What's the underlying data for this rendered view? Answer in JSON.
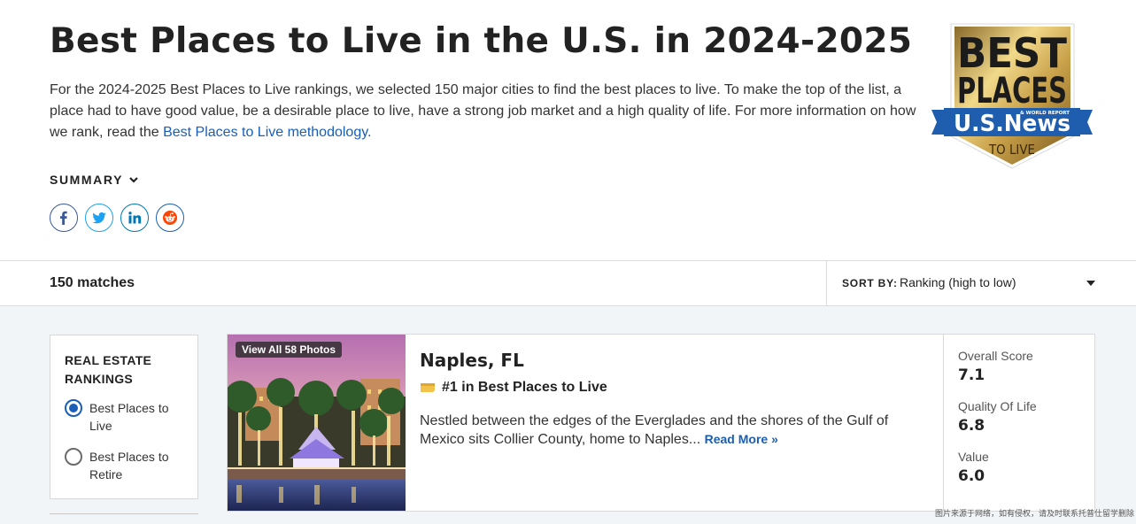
{
  "page": {
    "title": "Best Places to Live in the U.S. in 2024-2025",
    "intro_text": "For the 2024-2025 Best Places to Live rankings, we selected 150 major cities to find the best places to live. To make the top of the list, a place had to have good value, be a desirable place to live, have a strong job market and a high quality of life. For more information on how we rank, read the ",
    "intro_link": "Best Places to Live methodology.",
    "summary_label": "SUMMARY"
  },
  "badge": {
    "line1": "BEST",
    "line2": "PLACES",
    "brand": "U.S.News",
    "report": "& WORLD REPORT",
    "tagline": "TO LIVE"
  },
  "social": {
    "icons": [
      "facebook-icon",
      "twitter-icon",
      "linkedin-icon",
      "reddit-icon"
    ]
  },
  "toolbar": {
    "matches": "150 matches",
    "sort_label": "SORT BY:",
    "sort_value": "Ranking (high to low)"
  },
  "filter": {
    "title": "REAL ESTATE RANKINGS",
    "options": [
      {
        "label": "Best Places to Live",
        "selected": true
      },
      {
        "label": "Best Places to Retire",
        "selected": false
      }
    ]
  },
  "results": [
    {
      "photo_button": "View All 58 Photos",
      "city": "Naples, FL",
      "rank_text": "#1 in Best Places to Live",
      "description": "Nestled between the edges of the Everglades and the shores of the Gulf of Mexico sits Collier County, home to Naples... ",
      "read_more": "Read More »",
      "scores": [
        {
          "label": "Overall Score",
          "value": "7.1"
        },
        {
          "label": "Quality Of Life",
          "value": "6.8"
        },
        {
          "label": "Value",
          "value": "6.0"
        }
      ]
    }
  ],
  "watermark": "图片来源于网络，如有侵权，请及时联系托普仕留学删除",
  "colors": {
    "link": "#1a5eb7",
    "results_bg": "#f2f5f8",
    "badge_gold": "#c9a14a",
    "badge_blue": "#1f5dae"
  }
}
